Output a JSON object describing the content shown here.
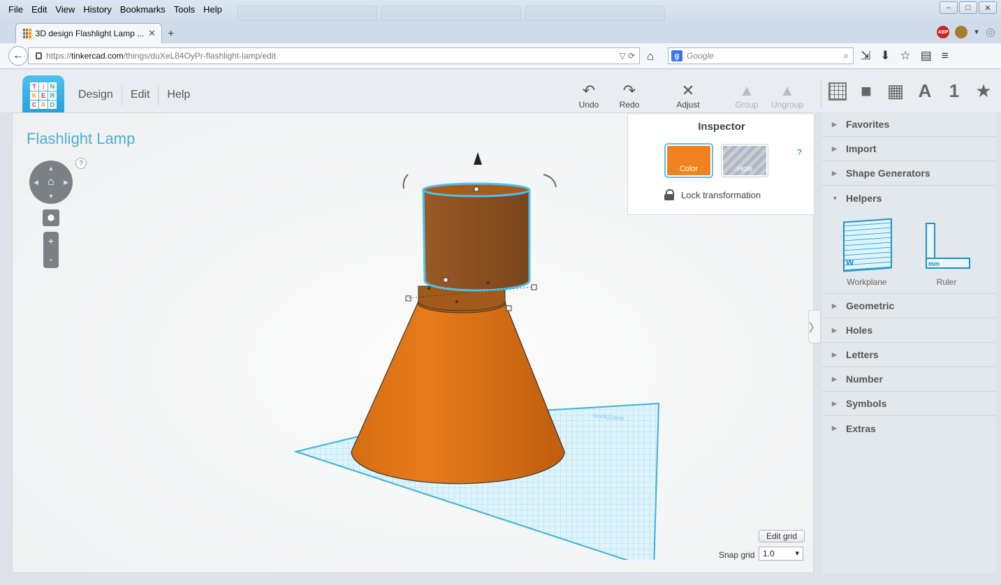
{
  "browser": {
    "menu": [
      "File",
      "Edit",
      "View",
      "History",
      "Bookmarks",
      "Tools",
      "Help"
    ],
    "tab_title": "3D design Flashlight Lamp ...",
    "url_prefix": "https://",
    "url_host": "tinkercad.com",
    "url_path": "/things/duXeL84OyPr-flashlight-lamp/edit",
    "search_placeholder": "Google"
  },
  "app": {
    "logo_letters": [
      "T",
      "I",
      "N",
      "K",
      "E",
      "R",
      "C",
      "A",
      "D"
    ],
    "menu": {
      "design": "Design",
      "edit": "Edit",
      "help": "Help"
    },
    "toolbar": {
      "undo": "Undo",
      "redo": "Redo",
      "adjust": "Adjust",
      "group": "Group",
      "ungroup": "Ungroup"
    },
    "view_icons": {
      "letters": "A",
      "number": "1"
    }
  },
  "workspace": {
    "design_title": "Flashlight Lamp",
    "help": "?",
    "zoom_in": "+",
    "zoom_out": "-",
    "edit_grid": "Edit grid",
    "snap_label": "Snap grid",
    "snap_value": "1.0"
  },
  "inspector": {
    "title": "Inspector",
    "help": "?",
    "color_label": "Color",
    "hole_label": "Hole",
    "lock_label": "Lock transformation",
    "color_value": "#f0831f"
  },
  "sidepanel": {
    "categories_top": [
      "Favorites",
      "Import",
      "Shape Generators"
    ],
    "helpers_label": "Helpers",
    "helpers": [
      "Workplane",
      "Ruler"
    ],
    "categories_bottom": [
      "Geometric",
      "Holes",
      "Letters",
      "Number",
      "Symbols",
      "Extras"
    ]
  }
}
